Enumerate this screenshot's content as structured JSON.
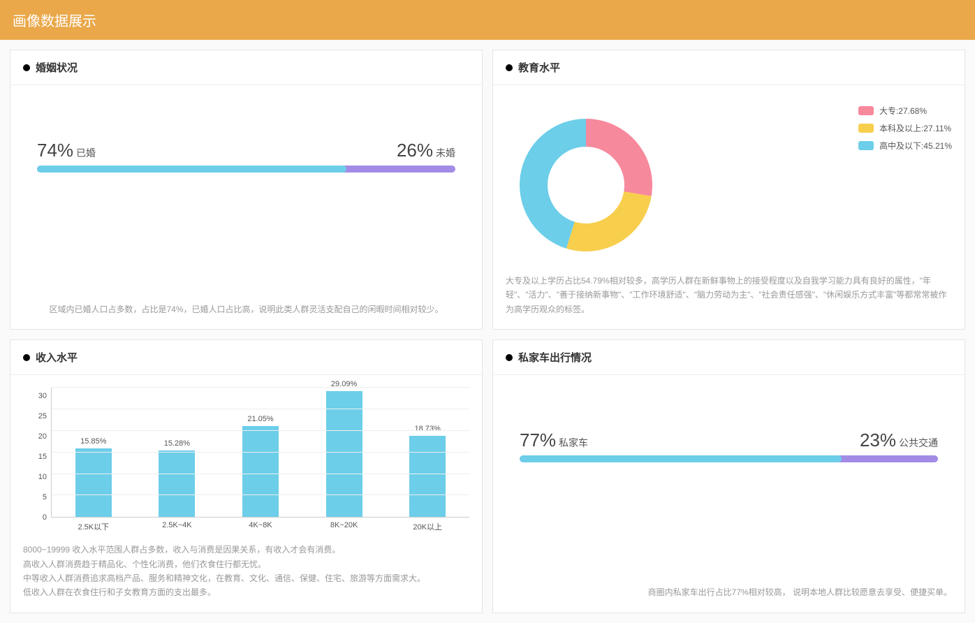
{
  "header_title": "画像数据展示",
  "marriage": {
    "title": "婚姻状况",
    "left_pct": "74%",
    "left_label": "已婚",
    "right_pct": "26%",
    "right_label": "未婚",
    "fill_pct": 74,
    "desc": "区域内已婚人口占多数，占比是74%，已婚人口占比高，说明此类人群灵活支配自己的闲暇时间相对较少。"
  },
  "education": {
    "title": "教育水平",
    "legend": [
      {
        "label": "大专:27.68%",
        "color": "#f7899c"
      },
      {
        "label": "本科及以上:27.11%",
        "color": "#f8ce4d"
      },
      {
        "label": "高中及以下:45.21%",
        "color": "#6ccee9"
      }
    ],
    "desc": "大专及以上学历占比54.79%相对较多，高学历人群在新鲜事物上的接受程度以及自我学习能力具有良好的属性，\"年轻\"、\"活力\"、\"善于接纳新事物\"、\"工作环境舒适\"、\"脑力劳动为主\"、\"社会责任感强\"、\"休闲娱乐方式丰富\"等都常常被作为高学历观众的标签。"
  },
  "income": {
    "title": "收入水平",
    "desc": "8000~19999 收入水平范围人群占多数，收入与消费是因果关系，有收入才会有消费。\n高收入人群消费趋于精品化、个性化消费，他们衣食住行都无忧。\n中等收入人群消费追求高档产品、服务和精神文化，在教育、文化、通信、保健、住宅、旅游等方面需求大。\n低收入人群在衣食住行和子女教育方面的支出最多。"
  },
  "car": {
    "title": "私家车出行情况",
    "left_pct": "77%",
    "left_label": "私家车",
    "right_pct": "23%",
    "right_label": "公共交通",
    "fill_pct": 77,
    "desc": "商圈内私家车出行占比77%相对较高，  说明本地人群比较愿意去享受、便捷买单。"
  },
  "chart_data": [
    {
      "type": "bar",
      "title": "收入水平",
      "categories": [
        "2.5K以下",
        "2.5K~4K",
        "4K~8K",
        "8K~20K",
        "20K以上"
      ],
      "values": [
        15.85,
        15.28,
        21.05,
        29.09,
        18.73
      ],
      "value_labels": [
        "15.85%",
        "15.28%",
        "21.05%",
        "29.09%",
        "18.73%"
      ],
      "ylim": [
        0,
        30
      ],
      "yticks": [
        0,
        5,
        10,
        15,
        20,
        25,
        30
      ],
      "ylabel": "",
      "xlabel": ""
    },
    {
      "type": "pie",
      "title": "教育水平",
      "series": [
        {
          "name": "大专",
          "value": 27.68,
          "color": "#f7899c"
        },
        {
          "name": "本科及以上",
          "value": 27.11,
          "color": "#f8ce4d"
        },
        {
          "name": "高中及以下",
          "value": 45.21,
          "color": "#6ccee9"
        }
      ]
    },
    {
      "type": "bar",
      "title": "婚姻状况",
      "categories": [
        "已婚",
        "未婚"
      ],
      "values": [
        74,
        26
      ]
    },
    {
      "type": "bar",
      "title": "私家车出行情况",
      "categories": [
        "私家车",
        "公共交通"
      ],
      "values": [
        77,
        23
      ]
    }
  ]
}
